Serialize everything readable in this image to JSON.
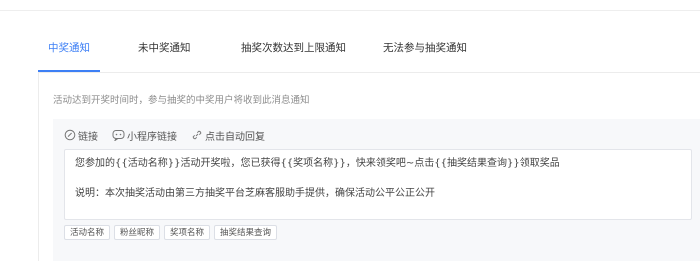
{
  "tabs": [
    {
      "label": "中奖通知",
      "active": true
    },
    {
      "label": "未中奖通知",
      "active": false
    },
    {
      "label": "抽奖次数达到上限通知",
      "active": false
    },
    {
      "label": "无法参与抽奖通知",
      "active": false
    }
  ],
  "panel": {
    "description": "活动达到开奖时间时，参与抽奖的中奖用户将收到此消息通知"
  },
  "toolbar": {
    "link_label": "链接",
    "miniprogram_label": "小程序链接",
    "autoreply_label": "点击自动回复",
    "link_icon": "link-icon",
    "miniprogram_icon": "miniprogram-icon",
    "autoreply_icon": "chain-icon"
  },
  "message": {
    "line1": "您参加的{{活动名称}}活动开奖啦，您已获得{{奖项名称}}，快来领奖吧~点击{{抽奖结果查询}}领取奖品",
    "line2": "说明：本次抽奖活动由第三方抽奖平台芝麻客服助手提供，确保活动公平公正公开"
  },
  "variables": [
    "活动名称",
    "粉丝昵称",
    "奖项名称",
    "抽奖结果查询"
  ],
  "colors": {
    "accent": "#3d7ff5",
    "editor_bg": "#f7f8fa"
  }
}
